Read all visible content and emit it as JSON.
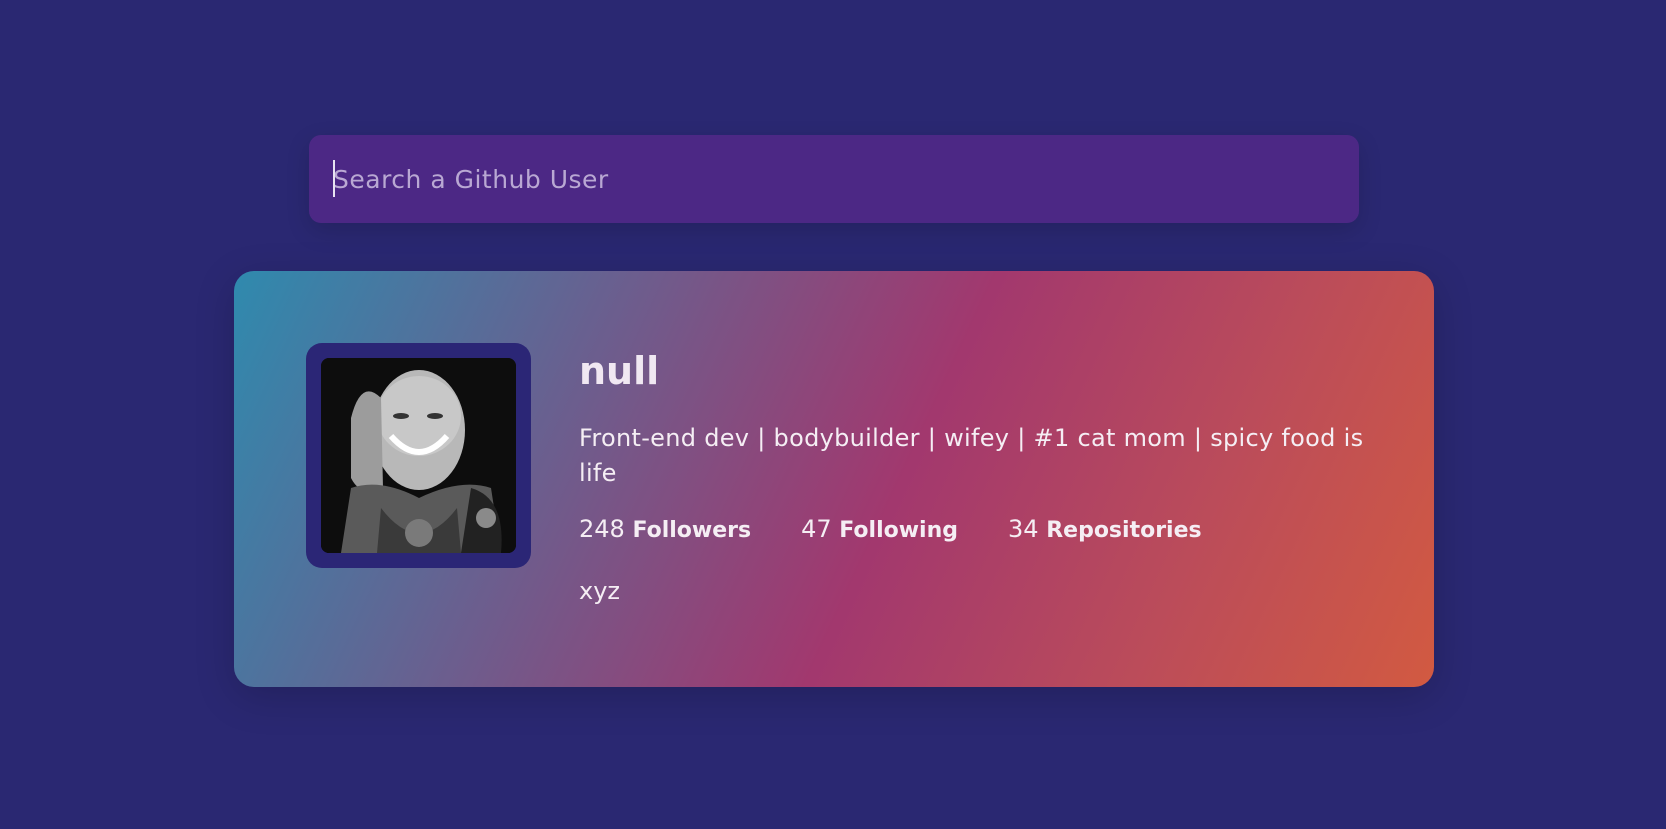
{
  "search": {
    "placeholder": "Search a Github User",
    "value": ""
  },
  "profile": {
    "name": "null",
    "bio": "Front-end dev | bodybuilder | wifey | #1 cat mom | spicy food is life",
    "stats": {
      "followers_count": "248",
      "followers_label": "Followers",
      "following_count": "47",
      "following_label": "Following",
      "repos_count": "34",
      "repos_label": "Repositories"
    },
    "extra": "xyz"
  },
  "colors": {
    "background": "#2a2872",
    "search_bg": "#4c2885",
    "card_gradient_start": "#2f8aae",
    "card_gradient_mid": "#a2386e",
    "card_gradient_end": "#d25a41",
    "avatar_frame": "#2b2676"
  }
}
